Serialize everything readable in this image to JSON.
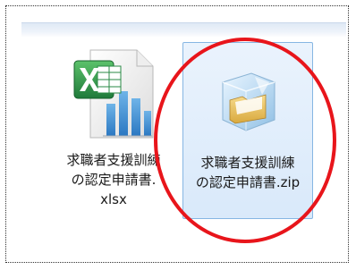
{
  "files": [
    {
      "name": "求職者支援訓練\nの認定申請書.\nxlsx",
      "icon": "excel-file-icon",
      "selected": false
    },
    {
      "name": "求職者支援訓練\nの認定申請書.zip",
      "icon": "zip-folder-icon",
      "selected": true
    }
  ],
  "colors": {
    "selection_border": "#86b6e3",
    "selection_fill": "#d9e9fa",
    "highlight_ring": "#e8151b",
    "excel_green": "#1f7a3a"
  }
}
